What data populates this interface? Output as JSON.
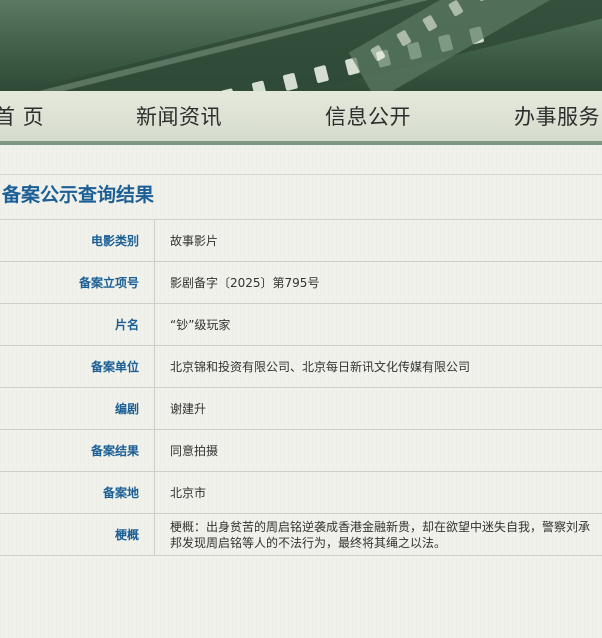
{
  "nav": {
    "items": [
      "首 页",
      "新闻资讯",
      "信息公开",
      "办事服务"
    ]
  },
  "result": {
    "title": "备案公示查询结果",
    "rows": [
      {
        "label": "电影类别",
        "value": "故事影片"
      },
      {
        "label": "备案立项号",
        "value": "影剧备字〔2025〕第795号"
      },
      {
        "label": "片名",
        "value": "“钞”级玩家"
      },
      {
        "label": "备案单位",
        "value": "北京锦和投资有限公司、北京每日新讯文化传媒有限公司"
      },
      {
        "label": "编剧",
        "value": "谢建升"
      },
      {
        "label": "备案结果",
        "value": "同意拍摄"
      },
      {
        "label": "备案地",
        "value": "北京市"
      },
      {
        "label": "梗概",
        "value": "梗概：出身贫苦的周启铭逆袭成香港金融新贵，却在欲望中迷失自我，警察刘承邦发现周启铭等人的不法行为，最终将其绳之以法。"
      }
    ]
  },
  "colors": {
    "banner": "#3f5f48",
    "nav_bg": "#dfe5d6",
    "label_blue": "#1c5f96",
    "accent_line": "#7e9782"
  }
}
